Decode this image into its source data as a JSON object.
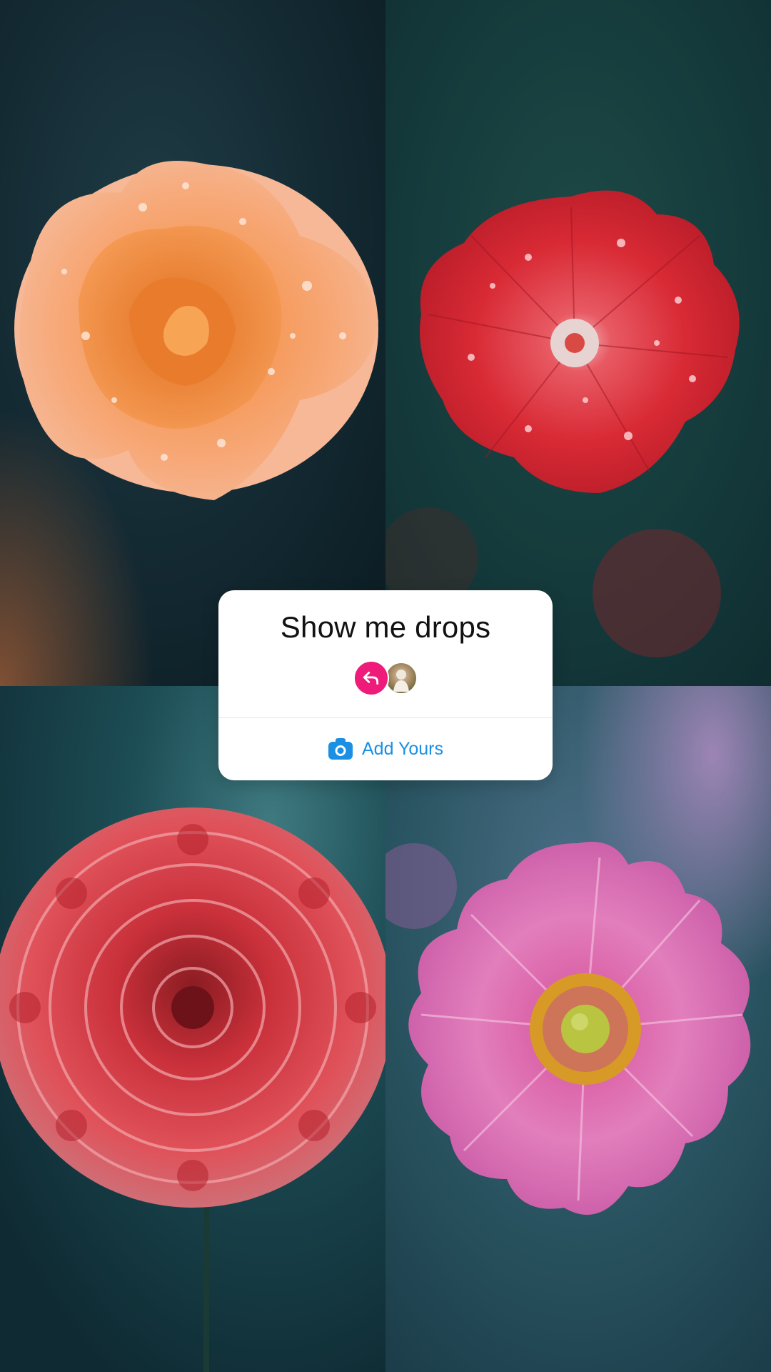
{
  "sticker": {
    "title": "Show me drops",
    "action_label": "Add Yours",
    "action_icon": "camera-icon",
    "reply_icon": "reply-arrow-icon"
  },
  "photos": [
    {
      "subject": "orange-rose-icon"
    },
    {
      "subject": "red-petunia-icon"
    },
    {
      "subject": "red-dahlia-icon"
    },
    {
      "subject": "pink-anemone-icon"
    }
  ],
  "colors": {
    "reply_badge": "#ee1b7a",
    "action_blue": "#1a8fe3",
    "card_bg": "#ffffff"
  }
}
